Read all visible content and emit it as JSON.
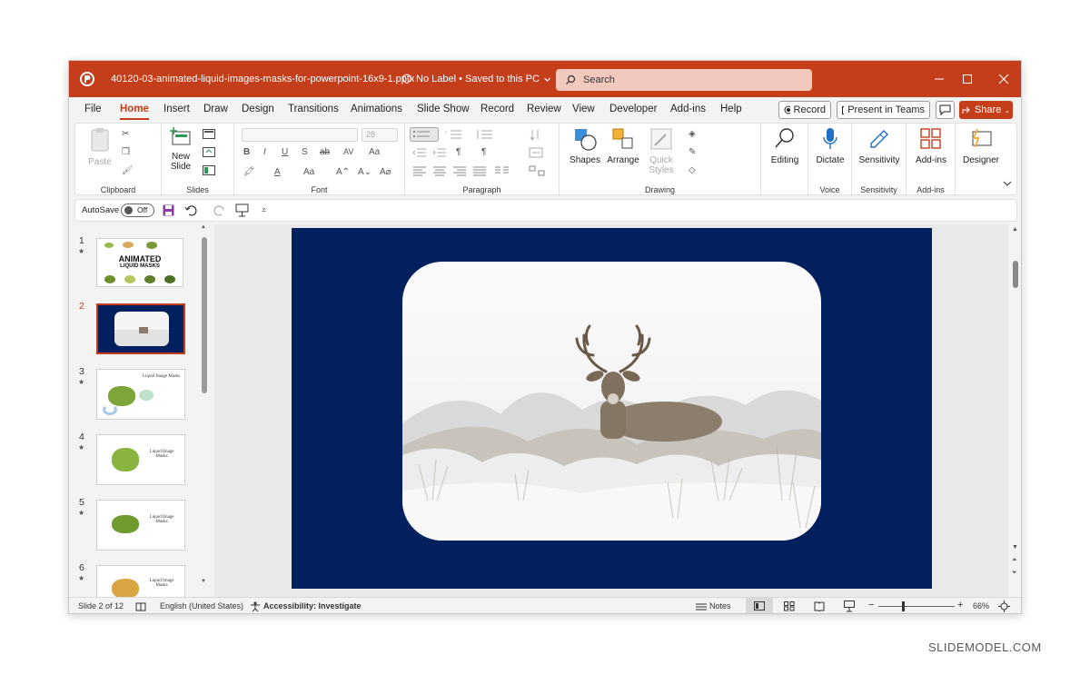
{
  "titlebar": {
    "filename": "40120-03-animated-liquid-images-masks-for-powerpoint-16x9-1.pptx",
    "label_status": "No Label • Saved to this PC",
    "search_placeholder": "Search"
  },
  "tabs": [
    "File",
    "Home",
    "Insert",
    "Draw",
    "Design",
    "Transitions",
    "Animations",
    "Slide Show",
    "Record",
    "Review",
    "View",
    "Developer",
    "Add-ins",
    "Help"
  ],
  "active_tab": "Home",
  "header_buttons": {
    "record": "Record",
    "present": "Present in Teams",
    "share": "Share"
  },
  "ribbon": {
    "clipboard": {
      "paste": "Paste",
      "label": "Clipboard"
    },
    "slides": {
      "new_slide_1": "New",
      "new_slide_2": "Slide",
      "label": "Slides"
    },
    "font": {
      "size": "28",
      "label": "Font"
    },
    "paragraph": {
      "label": "Paragraph"
    },
    "drawing": {
      "shapes": "Shapes",
      "arrange": "Arrange",
      "quick1": "Quick",
      "quick2": "Styles",
      "label": "Drawing"
    },
    "editing": {
      "label": "Editing"
    },
    "voice": {
      "dictate": "Dictate",
      "label": "Voice"
    },
    "sensitivity": {
      "btn": "Sensitivity",
      "label": "Sensitivity"
    },
    "addins": {
      "btn": "Add-ins",
      "label": "Add-ins"
    },
    "designer": {
      "btn": "Designer"
    }
  },
  "qat": {
    "autosave": "AutoSave",
    "toggle": "Off"
  },
  "thumbnails": [
    {
      "num": "1",
      "star": "★",
      "title_1": "ANIMATED",
      "title_2": "LIQUID MASKS"
    },
    {
      "num": "2",
      "star": ""
    },
    {
      "num": "3",
      "star": "★",
      "text": "Liquid Image Masks"
    },
    {
      "num": "4",
      "star": "★",
      "text": "Liquid Image Masks"
    },
    {
      "num": "5",
      "star": "★",
      "text": "Liquid Image Masks"
    },
    {
      "num": "6",
      "star": "★",
      "text": "Liquid Image Masks"
    }
  ],
  "status": {
    "slide": "Slide 2 of 12",
    "language": "English (United States)",
    "accessibility": "Accessibility: Investigate",
    "notes": "Notes",
    "zoom": "66%"
  },
  "credit": "SLIDEMODEL.COM",
  "colors": {
    "accent": "#c43e1c",
    "slide_bg": "#02205e"
  }
}
